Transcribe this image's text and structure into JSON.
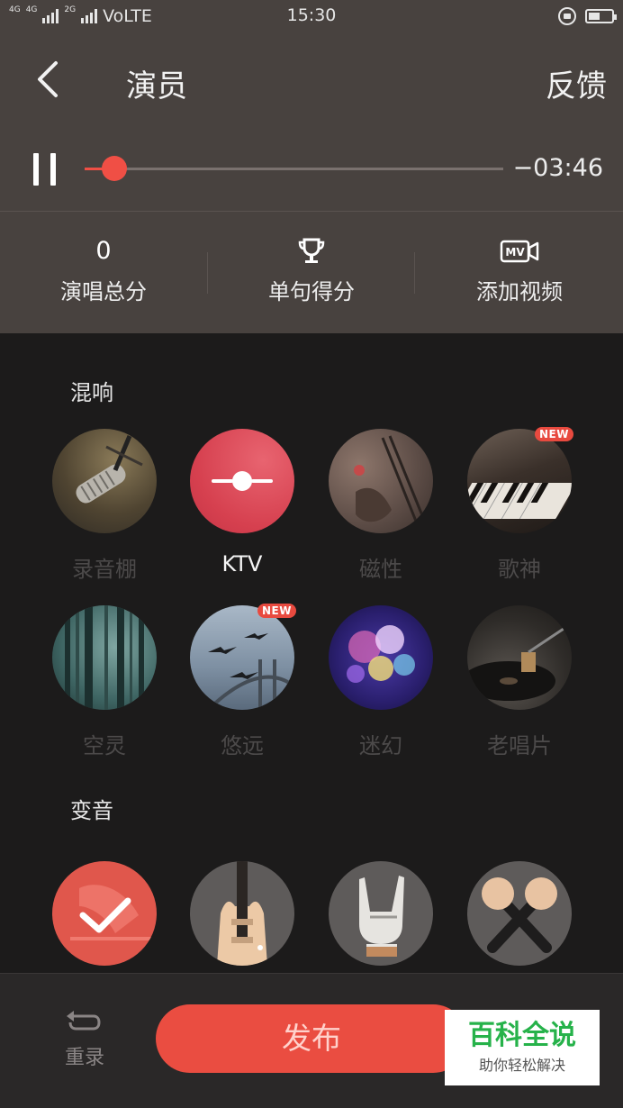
{
  "status_bar": {
    "network_left": "4G",
    "network_left2": "4G",
    "network_right": "2G",
    "volte": "VoLTE",
    "time": "15:30"
  },
  "header": {
    "title": "演员",
    "feedback": "反馈"
  },
  "player": {
    "remaining": "−03:46",
    "progress": 0.07
  },
  "stats": [
    {
      "value": "0",
      "label": "演唱总分"
    },
    {
      "icon": "trophy-icon",
      "label": "单句得分"
    },
    {
      "icon": "mv-icon",
      "label": "添加视频"
    }
  ],
  "sections": {
    "reverb": "混响",
    "voice_change": "变音"
  },
  "reverb_effects": [
    {
      "label": "录音棚",
      "icon": "studio-microphone-image",
      "active": false,
      "new": false
    },
    {
      "label": "KTV",
      "icon": "ktv-icon",
      "active": true,
      "new": false
    },
    {
      "label": "磁性",
      "icon": "guitar-image",
      "active": false,
      "new": false
    },
    {
      "label": "歌神",
      "icon": "piano-image",
      "active": false,
      "new": true
    },
    {
      "label": "空灵",
      "icon": "forest-image",
      "active": false,
      "new": false
    },
    {
      "label": "悠远",
      "icon": "birds-bridge-image",
      "active": false,
      "new": true
    },
    {
      "label": "迷幻",
      "icon": "bokeh-image",
      "active": false,
      "new": false
    },
    {
      "label": "老唱片",
      "icon": "record-player-image",
      "active": false,
      "new": false
    }
  ],
  "new_badge": "NEW",
  "voice_effects": [
    {
      "icon": "gramophone-check-icon",
      "active": true
    },
    {
      "icon": "electric-guitar-icon",
      "active": false
    },
    {
      "icon": "rock-hand-icon",
      "active": false
    },
    {
      "icon": "crossed-microphones-icon",
      "active": false
    }
  ],
  "bottom": {
    "redo": "重录",
    "publish": "发布"
  },
  "watermark": {
    "title": "百科全说",
    "subtitle": "助你轻松解决"
  },
  "colors": {
    "accent": "#ea4d41",
    "top_bg": "#48423f",
    "body_bg": "#1c1b1b"
  }
}
